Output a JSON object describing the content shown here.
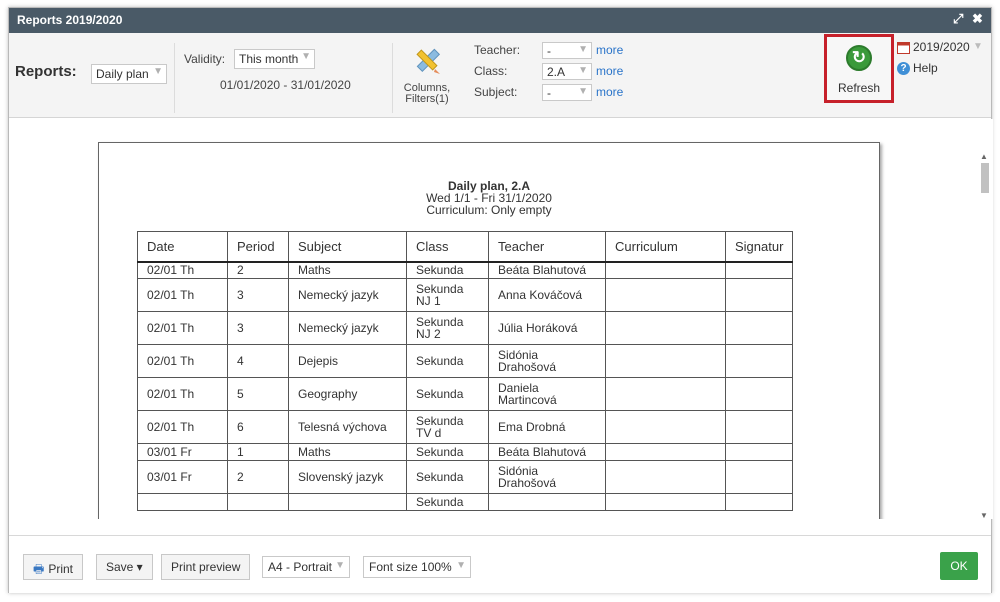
{
  "window": {
    "title": "Reports 2019/2020"
  },
  "toolbar": {
    "reports_label": "Reports:",
    "reports_value": "Daily plan",
    "validity_label": "Validity:",
    "validity_value": "This month",
    "date_range": "01/01/2020 - 31/01/2020",
    "columns_label_1": "Columns,",
    "columns_label_2": "Filters(1)",
    "teacher_label": "Teacher:",
    "teacher_value": "-",
    "class_label": "Class:",
    "class_value": "2.A",
    "subject_label": "Subject:",
    "subject_value": "-",
    "more": "more",
    "refresh": "Refresh",
    "year": "2019/2020",
    "help": "Help"
  },
  "report": {
    "title": "Daily plan, 2.A",
    "subtitle": "Wed 1/1 - Fri 31/1/2020",
    "curriculum": "Curriculum: Only empty",
    "columns": [
      "Date",
      "Period",
      "Subject",
      "Class",
      "Teacher",
      "Curriculum",
      "Signatur"
    ],
    "rows": [
      [
        "02/01 Th",
        "2",
        "Maths",
        "Sekunda",
        "Beáta Blahutová"
      ],
      [
        "02/01 Th",
        "3",
        "Nemecký jazyk",
        "Sekunda\nNJ 1",
        "Anna Kováčová"
      ],
      [
        "02/01 Th",
        "3",
        "Nemecký jazyk",
        "Sekunda\nNJ 2",
        "Júlia Horáková"
      ],
      [
        "02/01 Th",
        "4",
        "Dejepis",
        "Sekunda",
        "Sidónia\nDrahošová"
      ],
      [
        "02/01 Th",
        "5",
        "Geography",
        "Sekunda",
        "Daniela\nMartincová"
      ],
      [
        "02/01 Th",
        "6",
        "Telesná výchova",
        "Sekunda\nTV d",
        "Ema Drobná"
      ],
      [
        "03/01 Fr",
        "1",
        "Maths",
        "Sekunda",
        "Beáta Blahutová"
      ],
      [
        "03/01 Fr",
        "2",
        "Slovenský jazyk",
        "Sekunda",
        "Sidónia\nDrahošová"
      ],
      [
        "",
        "",
        "",
        "Sekunda",
        ""
      ]
    ]
  },
  "footer": {
    "print": "Print",
    "save": "Save ▾",
    "print_preview": "Print preview",
    "page_format": "A4 - Portrait",
    "font_size": "Font size 100%",
    "ok": "OK"
  },
  "colors": {
    "titlebar": "#4a5a67",
    "refresh_highlight": "#c6202a",
    "ok": "#3aa24a",
    "link": "#2a74c9"
  }
}
